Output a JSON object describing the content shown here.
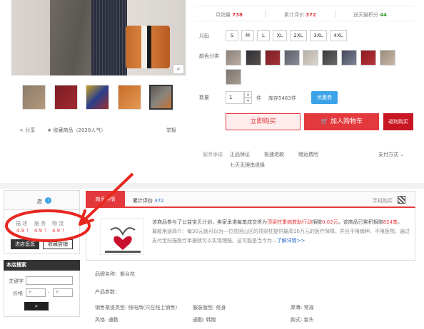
{
  "stats": {
    "monthly_sales_label": "月销量",
    "monthly_sales_value": "738",
    "reviews_label": "累计评价",
    "reviews_value": "372",
    "points_label": "送天猫积分",
    "points_value": "44"
  },
  "gallery": {
    "share": "分享",
    "favorite": "收藏商品（2028人气）",
    "report": "举报"
  },
  "sku": {
    "size_label": "尺码",
    "sizes": [
      "S",
      "M",
      "L",
      "XL",
      "2XL",
      "3XL",
      "4XL"
    ],
    "color_label": "颜色分类",
    "quantity_label": "数量",
    "quantity_value": "1",
    "unit": "件",
    "stock": "库存5463件",
    "coupon": "优惠券",
    "buy_now": "立即购买",
    "add_to_cart": "加入购物车",
    "rebate_buy": "返利购买"
  },
  "service": {
    "label": "服务承诺",
    "items": [
      "正品保证",
      "极速退款",
      "赠运费险"
    ],
    "return": "七天无理由退换",
    "payment": "支付方式 ⌄"
  },
  "shop": {
    "name": "店",
    "rating_labels": [
      "描 述",
      "服 务",
      "物 流"
    ],
    "rating_values": [
      "4.9 🡑",
      "4.9 🡑",
      "4.9 🡑"
    ],
    "enter_shop": "进店逛逛",
    "fav_shop": "收藏店铺"
  },
  "search": {
    "title": "本店搜索",
    "keyword_label": "关键字",
    "price_label": "价格",
    "price_from": "￥",
    "price_to": "￥",
    "dash": "-"
  },
  "tabs": {
    "details": "商品详情",
    "reviews": "累计评价",
    "reviews_count": "372",
    "mobile_buy": "手机购买"
  },
  "charity": {
    "text_1": "该商品参与了公益宝贝计划，卖家承诺每笔成交将为",
    "text_1_red": "顶梁柱重病救助行动",
    "text_1b": "捐赠",
    "text_1_amount": "0.02元",
    "text_1c": "。该商品已累积捐赠",
    "text_1_total": "824笔",
    "text_1d": "。",
    "text_2": "募款用途简介：每30元就可以为一位贫困山区的顶梁柱提供最高10万元的医疗保障，并且不限病种、不限医院，通过支付宝扫描医疗单据就可以实现理赔。这可能是当今为...",
    "more": "了解详情>>"
  },
  "attributes": {
    "brand": "品牌名称：紫台花",
    "params_head": "产品参数：",
    "row1": [
      "销售渠道类型: 纯电商(只在线上销售)",
      "服装版型: 修身",
      "厚薄: 常规"
    ],
    "row2": [
      "风格: 通勤",
      "通勤: 韩版",
      "款式: 套头"
    ]
  },
  "colors": {
    "accent": "#e4393c",
    "annotation": "#e8281f",
    "coupon": "#3ba3e8"
  }
}
